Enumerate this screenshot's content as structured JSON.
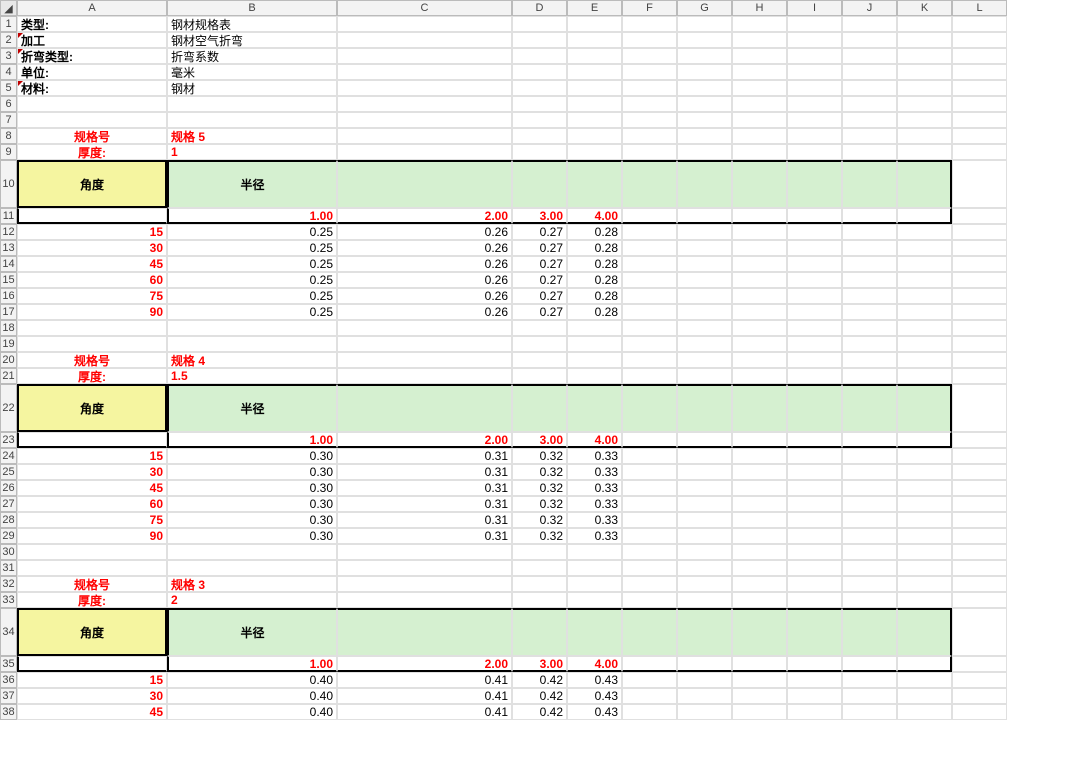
{
  "columns": [
    "A",
    "B",
    "C",
    "D",
    "E",
    "F",
    "G",
    "H",
    "I",
    "J",
    "K",
    "L"
  ],
  "rows": [
    1,
    2,
    3,
    4,
    5,
    6,
    7,
    8,
    9,
    10,
    11,
    12,
    13,
    14,
    15,
    16,
    17,
    18,
    19,
    20,
    21,
    22,
    23,
    24,
    25,
    26,
    27,
    28,
    29,
    30,
    31,
    32,
    33,
    34,
    35,
    36,
    37,
    38
  ],
  "row_heights": {
    "10": 48,
    "22": 48,
    "34": 48
  },
  "meta_labels": {
    "type": "类型:",
    "process": "加工",
    "bendtype": "折弯类型:",
    "unit": "单位:",
    "material": "材料:"
  },
  "meta_values": {
    "type": "钢材规格表",
    "process": "钢材空气折弯",
    "bendtype": "折弯系数",
    "unit": "毫米",
    "material": "钢材"
  },
  "labels": {
    "spec_no": "规格号",
    "thickness": "厚度:",
    "angle": "角度",
    "radius": "半径"
  },
  "blocks": [
    {
      "spec": "规格 5",
      "thickness": "1",
      "radii": [
        "1.00",
        "2.00",
        "3.00",
        "4.00"
      ],
      "angles": [
        "15",
        "30",
        "45",
        "60",
        "75",
        "90"
      ],
      "rows": [
        [
          "0.25",
          "0.26",
          "0.27",
          "0.28"
        ],
        [
          "0.25",
          "0.26",
          "0.27",
          "0.28"
        ],
        [
          "0.25",
          "0.26",
          "0.27",
          "0.28"
        ],
        [
          "0.25",
          "0.26",
          "0.27",
          "0.28"
        ],
        [
          "0.25",
          "0.26",
          "0.27",
          "0.28"
        ],
        [
          "0.25",
          "0.26",
          "0.27",
          "0.28"
        ]
      ]
    },
    {
      "spec": "规格 4",
      "thickness": "1.5",
      "radii": [
        "1.00",
        "2.00",
        "3.00",
        "4.00"
      ],
      "angles": [
        "15",
        "30",
        "45",
        "60",
        "75",
        "90"
      ],
      "rows": [
        [
          "0.30",
          "0.31",
          "0.32",
          "0.33"
        ],
        [
          "0.30",
          "0.31",
          "0.32",
          "0.33"
        ],
        [
          "0.30",
          "0.31",
          "0.32",
          "0.33"
        ],
        [
          "0.30",
          "0.31",
          "0.32",
          "0.33"
        ],
        [
          "0.30",
          "0.31",
          "0.32",
          "0.33"
        ],
        [
          "0.30",
          "0.31",
          "0.32",
          "0.33"
        ]
      ]
    },
    {
      "spec": "规格 3",
      "thickness": "2",
      "radii": [
        "1.00",
        "2.00",
        "3.00",
        "4.00"
      ],
      "angles": [
        "15",
        "30",
        "45"
      ],
      "rows": [
        [
          "0.40",
          "0.41",
          "0.42",
          "0.43"
        ],
        [
          "0.40",
          "0.41",
          "0.42",
          "0.43"
        ],
        [
          "0.40",
          "0.41",
          "0.42",
          "0.43"
        ]
      ]
    }
  ]
}
